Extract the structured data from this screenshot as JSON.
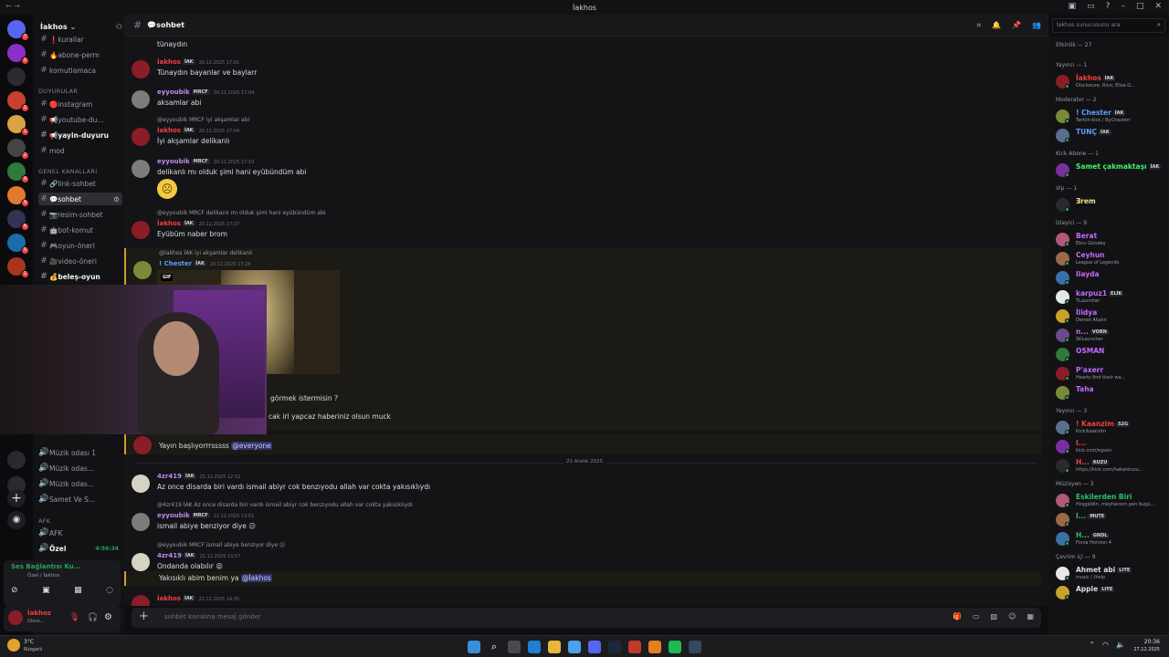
{
  "window": {
    "title": "İakhos"
  },
  "server": {
    "name": "İakhos"
  },
  "channel_sidebar": {
    "channels_top": [
      {
        "label": "❗kurallar"
      },
      {
        "label": "🔥abone-perm"
      },
      {
        "label": "komutlamaca"
      }
    ],
    "cat_announce": "DUYURULAR",
    "channels_announce": [
      {
        "label": "🔴instagram"
      },
      {
        "label": "📢youtube-du..."
      },
      {
        "label": "📢yayin-duyuru"
      },
      {
        "label": "mod"
      }
    ],
    "cat_general": "GENEL KANALLARI",
    "channels_general": [
      {
        "label": "🔗link-sohbet"
      },
      {
        "label": "💬sohbet"
      },
      {
        "label": "📷resim-sohbet"
      },
      {
        "label": "🤖bot-komut"
      },
      {
        "label": "🎮oyun-öneri"
      },
      {
        "label": "🎥video-öneri"
      },
      {
        "label": "💰beleş-oyun"
      }
    ],
    "voice_channels": [
      {
        "label": "Müzik odası 1"
      },
      {
        "label": "Müzik odas..."
      },
      {
        "label": "Müzik odas..."
      },
      {
        "label": "Samet Ve S..."
      }
    ],
    "cat_afk": "AFK",
    "afk_channel": "AFK",
    "ozel_label": "Özel",
    "ozel_timer": "4:56:34",
    "voice_panel": {
      "title": "Ses Bağlantısı Ku...",
      "subtitle": "Özel / İakhos"
    },
    "user_panel": {
      "name": "İakhos",
      "status": "Disco..."
    }
  },
  "header": {
    "channel": "💬sohbet",
    "search_placeholder": "İakhos sunucusunu ara"
  },
  "messages": [
    {
      "user": "",
      "text": "tünaydın"
    },
    {
      "user": "İakhos",
      "tag": "İAK",
      "ts": "20.12.2025 17:01",
      "text": "Tünaydın bayanlar ve baylarr"
    },
    {
      "user": "eyyoubik",
      "tag": "MRCF",
      "ts": "20.12.2025 17:04",
      "text": "aksamlar abi"
    },
    {
      "reply": "@eyyoubik  MRCF  iyi akşamlar abi",
      "user": "İakhos",
      "tag": "İAK",
      "ts": "20.12.2025 17:04",
      "text": "İyi akşamlar delikanlı"
    },
    {
      "user": "eyyoubik",
      "tag": "MRCF",
      "ts": "20.12.2025 17:10",
      "text": "delikanlı mı olduk şimi hani eyübündüm abi"
    },
    {
      "reply": "@eyyoubik  MRCF  delikanlı mı olduk şimi hani eyübündüm abi",
      "user": "İakhos",
      "tag": "İAK",
      "ts": "20.12.2025 17:27",
      "text": "Eyübüm naber brom"
    },
    {
      "reply": "@İakhos  İAK  iyi akşamlar delikanlı",
      "user": "! Chester",
      "tag": "İAK",
      "ts": "20.12.2025 17:28",
      "text": "GIF"
    },
    {
      "text": "görmek istermisin ?"
    },
    {
      "text": "cak irl yapcaz haberiniz olsun muck"
    },
    {
      "text": "Yayın başlıyorrrsssss",
      "mention": "@everyone"
    },
    {
      "divider": "21 Aralık 2025"
    },
    {
      "user": "4zr419",
      "tag": "İAK",
      "ts": "21.12.2025 12:52",
      "text": "Az once disarda biri vardı ismail abiyr cok benzıyodu allah var cokta yakısıklıydı"
    },
    {
      "reply": "@4zr419  İAK  Az once disarda biri vardı ismail abiyr cok benzıyodu allah var cokta yakısıklıydı",
      "user": "eyyoubik",
      "tag": "MRCF",
      "ts": "21.12.2025 13:52",
      "text": "ismail abiye benziyor diye 😕"
    },
    {
      "reply": "@eyyoubik  MRCF  ismail abiye benziyor diye 😕",
      "user": "4zr419",
      "tag": "İAK",
      "ts": "21.12.2025 13:57",
      "text": "Ondanda olabılır 😝"
    },
    {
      "text": "Yakısıklı abim benim ya",
      "mention": "@İakhos"
    },
    {
      "user": "İakhos",
      "tag": "İAK",
      "ts": "21.12.2025 14:35",
      "text": ""
    }
  ],
  "composer": {
    "placeholder": "sohbet kanalına mesaj gönder"
  },
  "members": {
    "activity": "Etkinlik — 27",
    "groups": [
      {
        "title": "Yayıncı — 1",
        "items": [
          {
            "name": "İakhos",
            "tag": "İAK",
            "sub": "Disclosure, Rivo, Eliza D...",
            "color": "#f23f43"
          }
        ]
      },
      {
        "title": "Moderator — 2",
        "items": [
          {
            "name": "! Chester",
            "tag": "İAK",
            "sub": "Twitch-kick / ByChesterr",
            "color": "#5aa0ff"
          },
          {
            "name": "TUNÇ",
            "tag": "İAK",
            "sub": "",
            "color": "#5aa0ff"
          }
        ]
      },
      {
        "title": "Kick Abone — 1",
        "items": [
          {
            "name": "Samet çakmaktaşı",
            "tag": "İAK",
            "sub": "",
            "color": "#3ff26b"
          }
        ]
      },
      {
        "title": "Vip — 1",
        "items": [
          {
            "name": "Ǝrem",
            "tag": "",
            "sub": "",
            "color": "#f0e08a"
          }
        ]
      },
      {
        "title": "İzleyici — 9",
        "items": [
          {
            "name": "Berat",
            "sub": "Ebru Gündeş",
            "color": "#c26bff"
          },
          {
            "name": "Ceyhun",
            "sub": "League of Legends",
            "color": "#c26bff"
          },
          {
            "name": "Ilayda",
            "sub": "",
            "color": "#c26bff"
          },
          {
            "name": "karpuz1",
            "tag": "ELİK",
            "sub": "TLauncher",
            "color": "#c26bff"
          },
          {
            "name": "İlidya",
            "sub": "Demet Akalın",
            "color": "#c26bff"
          },
          {
            "name": "n...",
            "tag": "VORN",
            "sub": "SKLauncher",
            "color": "#c26bff"
          },
          {
            "name": "OSMAN",
            "sub": "",
            "color": "#c26bff"
          },
          {
            "name": "P'axerr",
            "sub": "Hearts find their wa...",
            "color": "#c26bff"
          },
          {
            "name": "Taha",
            "sub": "",
            "color": "#c26bff"
          }
        ]
      },
      {
        "title": "Yayıncı — 3",
        "items": [
          {
            "name": "! Kaanzim",
            "tag": "S2G",
            "sub": "Kick/kaanzim",
            "color": "#f23f43"
          },
          {
            "name": "I...",
            "sub": "kick.com/egsen",
            "color": "#f23f43"
          },
          {
            "name": "H...",
            "tag": "KUZU",
            "sub": "https://kick.com/hakankuzu...",
            "color": "#f23f43"
          }
        ]
      },
      {
        "title": "Müzisyen — 3",
        "items": [
          {
            "name": "Eskilerden Biri",
            "sub": "Hoşgeldin, meyhanem pen bugü...",
            "color": "#2fbf71"
          },
          {
            "name": "I...",
            "tag": "MUTE",
            "sub": "",
            "color": "#2fbf71"
          },
          {
            "name": "H...",
            "tag": "GNDL",
            "sub": "Forza Horizon 4",
            "color": "#2fbf71"
          }
        ]
      },
      {
        "title": "Çevrim içi — 9",
        "items": [
          {
            "name": "Ahmet abi",
            "tag": "LIYE",
            "sub": "music / /help",
            "color": "#dbdee1"
          },
          {
            "name": "Apple",
            "tag": "LIYE",
            "sub": "",
            "color": "#dbdee1"
          }
        ]
      }
    ]
  },
  "taskbar": {
    "weather_temp": "3°C",
    "weather_desc": "Rüzgarlı",
    "time": "20:36",
    "date": "27.12.2025"
  },
  "colors": {
    "accent": "#5865f2",
    "danger": "#f23f43",
    "online": "#23a55a"
  }
}
